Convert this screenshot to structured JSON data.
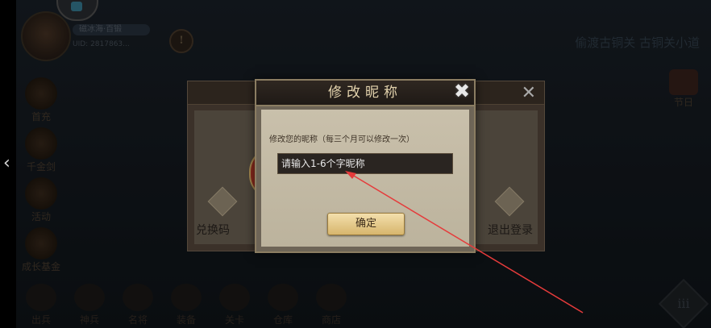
{
  "hud": {
    "profile_name": "磁冰海·百锻",
    "profile_uid": "UID: 2817863...",
    "quest_text": "偷渡古铜关 古铜关小道",
    "left_menu": [
      "首充",
      "千金剑",
      "活动",
      "成长基金"
    ],
    "right_event": "节日",
    "bottom_bar": [
      "出兵",
      "神兵",
      "名将",
      "装备",
      "关卡",
      "仓库",
      "商店"
    ],
    "menu_button_icon": "iii"
  },
  "settings_panel": {
    "redeem_label": "兑换码",
    "logout_label": "退出登录"
  },
  "nickname_dialog": {
    "title": "修改昵称",
    "hint": "修改您的昵称（每三个月可以修改一次）",
    "input_placeholder": "请输入1-6个字昵称",
    "confirm_label": "确定"
  },
  "icons": {
    "back": "chevron-left-icon",
    "close": "close-icon",
    "info": "info-icon",
    "gift": "gift-icon",
    "exit": "exit-icon"
  },
  "colors": {
    "dialog_title": "#e3d3ad",
    "confirm_button": "#e6c985",
    "annotation_arrow": "#e53b3b"
  }
}
